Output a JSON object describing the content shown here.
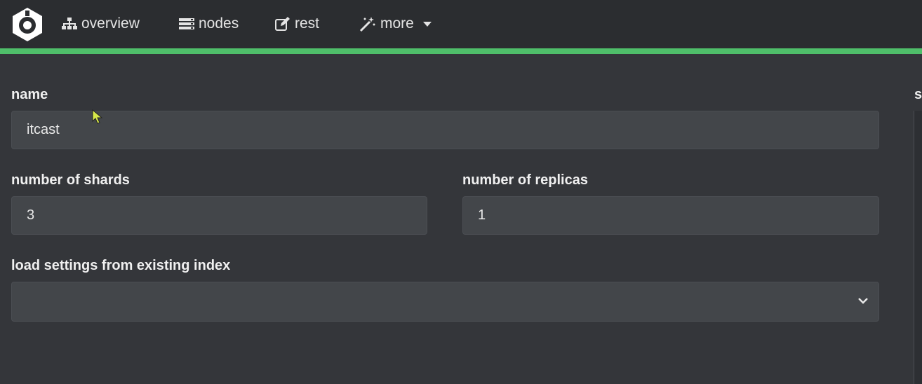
{
  "colors": {
    "accent": "#4fbf6a",
    "navbar_bg": "#2b2d30",
    "page_bg": "#34363a",
    "field_bg": "#43464a"
  },
  "nav": {
    "logo_icon": "hexagon-logo-icon",
    "items": [
      {
        "label": "overview",
        "icon": "sitemap-icon"
      },
      {
        "label": "nodes",
        "icon": "server-icon"
      },
      {
        "label": "rest",
        "icon": "edit-icon"
      },
      {
        "label": "more",
        "icon": "magic-wand-icon",
        "dropdown_icon": "caret-down-icon"
      }
    ]
  },
  "form": {
    "name": {
      "label": "name",
      "value": "itcast"
    },
    "shards": {
      "label": "number of shards",
      "value": "3"
    },
    "replicas": {
      "label": "number of replicas",
      "value": "1"
    },
    "load_settings": {
      "label": "load settings from existing index",
      "selected": "",
      "icon": "chevron-down-icon"
    }
  },
  "right_panel": {
    "label": "s"
  }
}
